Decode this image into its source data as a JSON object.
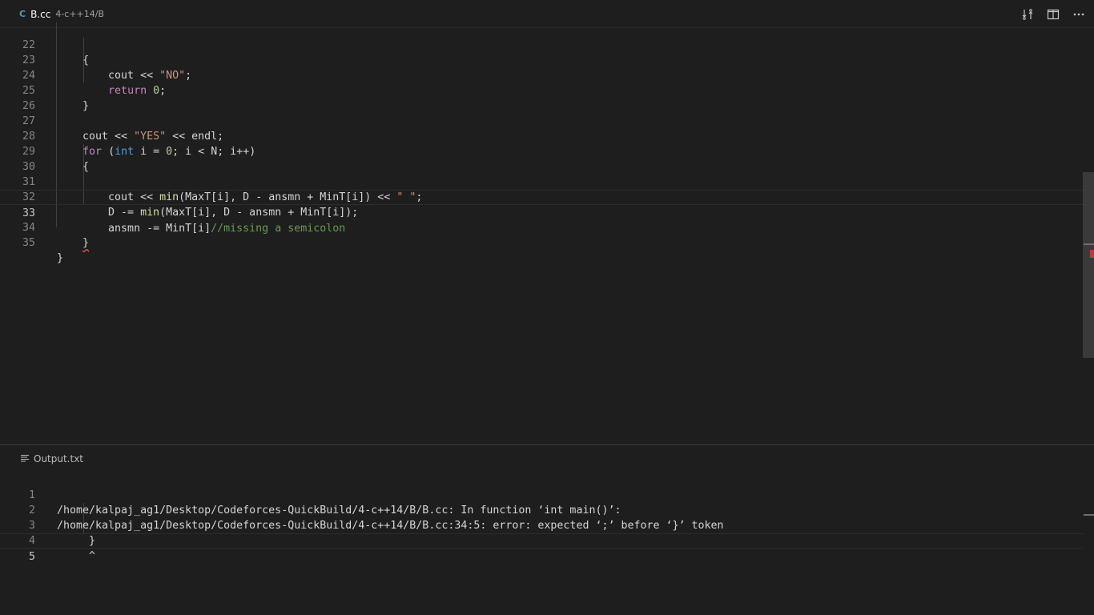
{
  "tab": {
    "icon": "C",
    "file_name": "B.cc",
    "file_path": "4-c++14/B"
  },
  "actions": [
    {
      "name": "open-changes-icon",
      "glyph": "⇆"
    },
    {
      "name": "split-editor-icon",
      "glyph": "◫"
    },
    {
      "name": "more-actions-icon",
      "glyph": "···"
    }
  ],
  "editor": {
    "lines": [
      {
        "n": "22",
        "text": "    {"
      },
      {
        "n": "23",
        "text": "        cout << \"NO\";"
      },
      {
        "n": "24",
        "text": "        return 0;"
      },
      {
        "n": "25",
        "text": "    }"
      },
      {
        "n": "26",
        "text": ""
      },
      {
        "n": "27",
        "text": "    cout << \"YES\" << endl;"
      },
      {
        "n": "28",
        "text": "    for (int i = 0; i < N; i++)"
      },
      {
        "n": "29",
        "text": "    {"
      },
      {
        "n": "30",
        "text": ""
      },
      {
        "n": "31",
        "text": "        cout << min(MaxT[i], D - ansmn + MinT[i]) << \" \";"
      },
      {
        "n": "32",
        "text": "        D -= min(MaxT[i], D - ansmn + MinT[i]);"
      },
      {
        "n": "33",
        "text": "        ansmn -= MinT[i]//missing a semicolon"
      },
      {
        "n": "34",
        "text": "    }"
      },
      {
        "n": "35",
        "text": "}"
      }
    ]
  },
  "output_panel": {
    "title": "Output.txt",
    "lines": [
      {
        "n": "1",
        "text": "/home/kalpaj_ag1/Desktop/Codeforces-QuickBuild/4-c++14/B/B.cc: In function ‘int main()’:"
      },
      {
        "n": "2",
        "text": "/home/kalpaj_ag1/Desktop/Codeforces-QuickBuild/4-c++14/B/B.cc:34:5: error: expected ‘;’ before ‘}’ token"
      },
      {
        "n": "3",
        "text": "     }"
      },
      {
        "n": "4",
        "text": "     ^"
      },
      {
        "n": "5",
        "text": ""
      }
    ]
  },
  "colors": {
    "background": "#1e1e1e",
    "keyword": "#c586c0",
    "type": "#569cd6",
    "string": "#ce9178",
    "number": "#b5cea8",
    "function": "#dcdcaa",
    "comment": "#6a9955",
    "error": "#f14c4c"
  }
}
